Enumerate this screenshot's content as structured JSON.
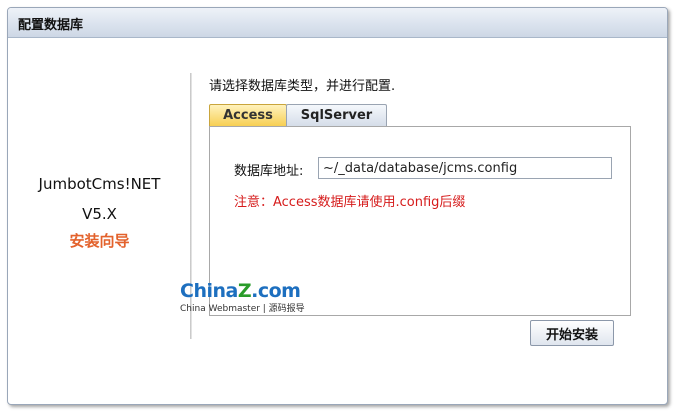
{
  "window": {
    "title": "配置数据库"
  },
  "product": {
    "name": "JumbotCms!NET",
    "version": "V5.X",
    "subtitle": "安装向导"
  },
  "main": {
    "intro": "请选择数据库类型，并进行配置.",
    "tabs": [
      {
        "label": "Access",
        "active": true
      },
      {
        "label": "SqlServer",
        "active": false
      }
    ],
    "access": {
      "db_label": "数据库地址:",
      "db_value": "~/_data/database/jcms.config",
      "note": "注意：Access数据库请使用.config后缀"
    },
    "install_button": "开始安装"
  },
  "watermark": {
    "logo_a": "China",
    "logo_b": "Z",
    "logo_c": ".com",
    "sub": "China Webmaster | 源码报导"
  },
  "colors": {
    "accent_orange": "#e3622c",
    "note_red": "#d61c1c",
    "tab_active": "#f7cf53"
  }
}
